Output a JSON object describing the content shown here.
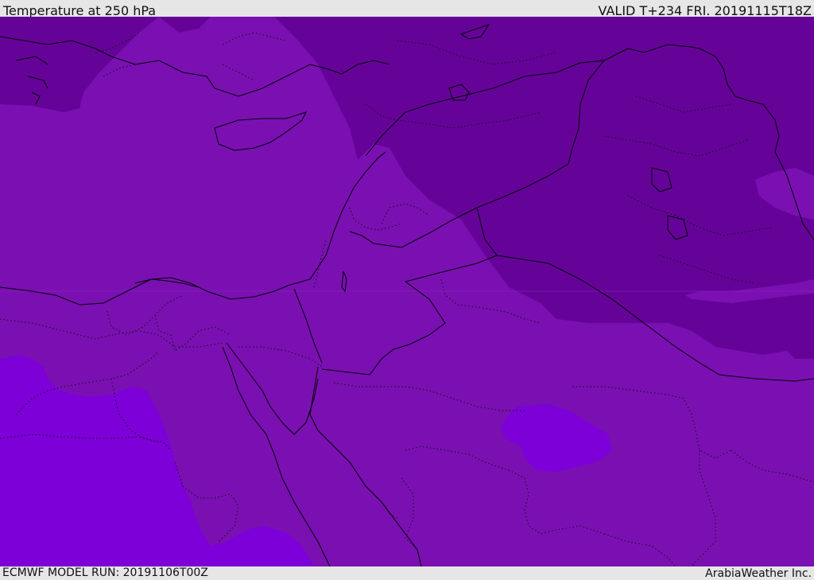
{
  "header": {
    "title": "Temperature at 250 hPa",
    "valid": "VALID T+234 FRI. 20191115T18Z"
  },
  "footer": {
    "model_run": "ECMWF MODEL RUN: 20191106T00Z",
    "brand": "ArabiaWeather Inc."
  },
  "colors": {
    "colder_band": "#650399",
    "main_band": "#7a10b2",
    "warmer_band": "#7d00d8",
    "border_line": "#000000"
  }
}
